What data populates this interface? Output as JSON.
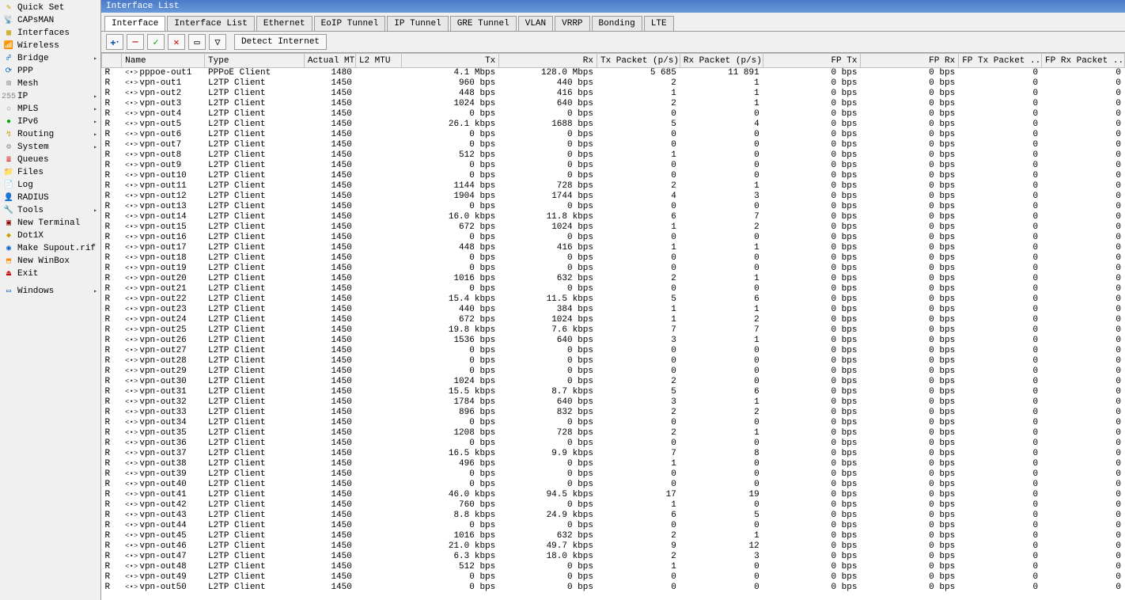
{
  "sidebar": [
    {
      "label": "Quick Set",
      "icon": "✎",
      "color": "#c8a000"
    },
    {
      "label": "CAPsMAN",
      "icon": "📡",
      "color": "#c00"
    },
    {
      "label": "Interfaces",
      "icon": "▦",
      "color": "#c8a000"
    },
    {
      "label": "Wireless",
      "icon": "📶",
      "color": "#06c"
    },
    {
      "label": "Bridge",
      "icon": "☍",
      "color": "#06c",
      "arrow": true
    },
    {
      "label": "PPP",
      "icon": "⟳",
      "color": "#06c"
    },
    {
      "label": "Mesh",
      "icon": "⊞",
      "color": "#888"
    },
    {
      "label": "IP",
      "icon": "255",
      "color": "#888",
      "arrow": true
    },
    {
      "label": "MPLS",
      "icon": "○",
      "color": "#888",
      "arrow": true
    },
    {
      "label": "IPv6",
      "icon": "●",
      "color": "#0a0",
      "arrow": true
    },
    {
      "label": "Routing",
      "icon": "↯",
      "color": "#c8a000",
      "arrow": true
    },
    {
      "label": "System",
      "icon": "⚙",
      "color": "#888",
      "arrow": true
    },
    {
      "label": "Queues",
      "icon": "≣",
      "color": "#c00"
    },
    {
      "label": "Files",
      "icon": "📁",
      "color": "#06c"
    },
    {
      "label": "Log",
      "icon": "📄",
      "color": "#888"
    },
    {
      "label": "RADIUS",
      "icon": "👤",
      "color": "#c8a000"
    },
    {
      "label": "Tools",
      "icon": "🔧",
      "color": "#888",
      "arrow": true
    },
    {
      "label": "New Terminal",
      "icon": "▣",
      "color": "#800"
    },
    {
      "label": "Dot1X",
      "icon": "◆",
      "color": "#c8a000"
    },
    {
      "label": "Make Supout.rif",
      "icon": "◉",
      "color": "#06c"
    },
    {
      "label": "New WinBox",
      "icon": "⬒",
      "color": "#f80"
    },
    {
      "label": "Exit",
      "icon": "⏏",
      "color": "#c00"
    }
  ],
  "windows_label": "Windows",
  "window_title": "Interface List",
  "tabs": [
    "Interface",
    "Interface List",
    "Ethernet",
    "EoIP Tunnel",
    "IP Tunnel",
    "GRE Tunnel",
    "VLAN",
    "VRRP",
    "Bonding",
    "LTE"
  ],
  "active_tab": 0,
  "detect_label": "Detect Internet",
  "columns": [
    "",
    "Name",
    "Type",
    "Actual MTU",
    "L2 MTU",
    "Tx",
    "Rx",
    "Tx Packet (p/s)",
    "Rx Packet (p/s)",
    "FP Tx",
    "FP Rx",
    "FP Tx Packet ...",
    "FP Rx Packet ..."
  ],
  "rows": [
    {
      "flag": "R",
      "name": "pppoe-out1",
      "type": "PPPoE Client",
      "mtu": "1480",
      "l2": "",
      "tx": "4.1 Mbps",
      "rx": "128.0 Mbps",
      "txp": "5 685",
      "rxp": "11 891",
      "fptx": "0 bps",
      "fprx": "0 bps",
      "fptxp": "0",
      "fprxp": "0"
    },
    {
      "flag": "R",
      "name": "vpn-out1",
      "type": "L2TP Client",
      "mtu": "1450",
      "l2": "",
      "tx": "960 bps",
      "rx": "440 bps",
      "txp": "2",
      "rxp": "1",
      "fptx": "0 bps",
      "fprx": "0 bps",
      "fptxp": "0",
      "fprxp": "0"
    },
    {
      "flag": "R",
      "name": "vpn-out2",
      "type": "L2TP Client",
      "mtu": "1450",
      "l2": "",
      "tx": "448 bps",
      "rx": "416 bps",
      "txp": "1",
      "rxp": "1",
      "fptx": "0 bps",
      "fprx": "0 bps",
      "fptxp": "0",
      "fprxp": "0"
    },
    {
      "flag": "R",
      "name": "vpn-out3",
      "type": "L2TP Client",
      "mtu": "1450",
      "l2": "",
      "tx": "1024 bps",
      "rx": "640 bps",
      "txp": "2",
      "rxp": "1",
      "fptx": "0 bps",
      "fprx": "0 bps",
      "fptxp": "0",
      "fprxp": "0"
    },
    {
      "flag": "R",
      "name": "vpn-out4",
      "type": "L2TP Client",
      "mtu": "1450",
      "l2": "",
      "tx": "0 bps",
      "rx": "0 bps",
      "txp": "0",
      "rxp": "0",
      "fptx": "0 bps",
      "fprx": "0 bps",
      "fptxp": "0",
      "fprxp": "0"
    },
    {
      "flag": "R",
      "name": "vpn-out5",
      "type": "L2TP Client",
      "mtu": "1450",
      "l2": "",
      "tx": "26.1 kbps",
      "rx": "1688 bps",
      "txp": "5",
      "rxp": "4",
      "fptx": "0 bps",
      "fprx": "0 bps",
      "fptxp": "0",
      "fprxp": "0"
    },
    {
      "flag": "R",
      "name": "vpn-out6",
      "type": "L2TP Client",
      "mtu": "1450",
      "l2": "",
      "tx": "0 bps",
      "rx": "0 bps",
      "txp": "0",
      "rxp": "0",
      "fptx": "0 bps",
      "fprx": "0 bps",
      "fptxp": "0",
      "fprxp": "0"
    },
    {
      "flag": "R",
      "name": "vpn-out7",
      "type": "L2TP Client",
      "mtu": "1450",
      "l2": "",
      "tx": "0 bps",
      "rx": "0 bps",
      "txp": "0",
      "rxp": "0",
      "fptx": "0 bps",
      "fprx": "0 bps",
      "fptxp": "0",
      "fprxp": "0"
    },
    {
      "flag": "R",
      "name": "vpn-out8",
      "type": "L2TP Client",
      "mtu": "1450",
      "l2": "",
      "tx": "512 bps",
      "rx": "0 bps",
      "txp": "1",
      "rxp": "0",
      "fptx": "0 bps",
      "fprx": "0 bps",
      "fptxp": "0",
      "fprxp": "0"
    },
    {
      "flag": "R",
      "name": "vpn-out9",
      "type": "L2TP Client",
      "mtu": "1450",
      "l2": "",
      "tx": "0 bps",
      "rx": "0 bps",
      "txp": "0",
      "rxp": "0",
      "fptx": "0 bps",
      "fprx": "0 bps",
      "fptxp": "0",
      "fprxp": "0"
    },
    {
      "flag": "R",
      "name": "vpn-out10",
      "type": "L2TP Client",
      "mtu": "1450",
      "l2": "",
      "tx": "0 bps",
      "rx": "0 bps",
      "txp": "0",
      "rxp": "0",
      "fptx": "0 bps",
      "fprx": "0 bps",
      "fptxp": "0",
      "fprxp": "0"
    },
    {
      "flag": "R",
      "name": "vpn-out11",
      "type": "L2TP Client",
      "mtu": "1450",
      "l2": "",
      "tx": "1144 bps",
      "rx": "728 bps",
      "txp": "2",
      "rxp": "1",
      "fptx": "0 bps",
      "fprx": "0 bps",
      "fptxp": "0",
      "fprxp": "0"
    },
    {
      "flag": "R",
      "name": "vpn-out12",
      "type": "L2TP Client",
      "mtu": "1450",
      "l2": "",
      "tx": "1904 bps",
      "rx": "1744 bps",
      "txp": "4",
      "rxp": "3",
      "fptx": "0 bps",
      "fprx": "0 bps",
      "fptxp": "0",
      "fprxp": "0"
    },
    {
      "flag": "R",
      "name": "vpn-out13",
      "type": "L2TP Client",
      "mtu": "1450",
      "l2": "",
      "tx": "0 bps",
      "rx": "0 bps",
      "txp": "0",
      "rxp": "0",
      "fptx": "0 bps",
      "fprx": "0 bps",
      "fptxp": "0",
      "fprxp": "0"
    },
    {
      "flag": "R",
      "name": "vpn-out14",
      "type": "L2TP Client",
      "mtu": "1450",
      "l2": "",
      "tx": "16.0 kbps",
      "rx": "11.8 kbps",
      "txp": "6",
      "rxp": "7",
      "fptx": "0 bps",
      "fprx": "0 bps",
      "fptxp": "0",
      "fprxp": "0"
    },
    {
      "flag": "R",
      "name": "vpn-out15",
      "type": "L2TP Client",
      "mtu": "1450",
      "l2": "",
      "tx": "672 bps",
      "rx": "1024 bps",
      "txp": "1",
      "rxp": "2",
      "fptx": "0 bps",
      "fprx": "0 bps",
      "fptxp": "0",
      "fprxp": "0"
    },
    {
      "flag": "R",
      "name": "vpn-out16",
      "type": "L2TP Client",
      "mtu": "1450",
      "l2": "",
      "tx": "0 bps",
      "rx": "0 bps",
      "txp": "0",
      "rxp": "0",
      "fptx": "0 bps",
      "fprx": "0 bps",
      "fptxp": "0",
      "fprxp": "0"
    },
    {
      "flag": "R",
      "name": "vpn-out17",
      "type": "L2TP Client",
      "mtu": "1450",
      "l2": "",
      "tx": "448 bps",
      "rx": "416 bps",
      "txp": "1",
      "rxp": "1",
      "fptx": "0 bps",
      "fprx": "0 bps",
      "fptxp": "0",
      "fprxp": "0"
    },
    {
      "flag": "R",
      "name": "vpn-out18",
      "type": "L2TP Client",
      "mtu": "1450",
      "l2": "",
      "tx": "0 bps",
      "rx": "0 bps",
      "txp": "0",
      "rxp": "0",
      "fptx": "0 bps",
      "fprx": "0 bps",
      "fptxp": "0",
      "fprxp": "0"
    },
    {
      "flag": "R",
      "name": "vpn-out19",
      "type": "L2TP Client",
      "mtu": "1450",
      "l2": "",
      "tx": "0 bps",
      "rx": "0 bps",
      "txp": "0",
      "rxp": "0",
      "fptx": "0 bps",
      "fprx": "0 bps",
      "fptxp": "0",
      "fprxp": "0"
    },
    {
      "flag": "R",
      "name": "vpn-out20",
      "type": "L2TP Client",
      "mtu": "1450",
      "l2": "",
      "tx": "1016 bps",
      "rx": "632 bps",
      "txp": "2",
      "rxp": "1",
      "fptx": "0 bps",
      "fprx": "0 bps",
      "fptxp": "0",
      "fprxp": "0"
    },
    {
      "flag": "R",
      "name": "vpn-out21",
      "type": "L2TP Client",
      "mtu": "1450",
      "l2": "",
      "tx": "0 bps",
      "rx": "0 bps",
      "txp": "0",
      "rxp": "0",
      "fptx": "0 bps",
      "fprx": "0 bps",
      "fptxp": "0",
      "fprxp": "0"
    },
    {
      "flag": "R",
      "name": "vpn-out22",
      "type": "L2TP Client",
      "mtu": "1450",
      "l2": "",
      "tx": "15.4 kbps",
      "rx": "11.5 kbps",
      "txp": "5",
      "rxp": "6",
      "fptx": "0 bps",
      "fprx": "0 bps",
      "fptxp": "0",
      "fprxp": "0"
    },
    {
      "flag": "R",
      "name": "vpn-out23",
      "type": "L2TP Client",
      "mtu": "1450",
      "l2": "",
      "tx": "440 bps",
      "rx": "384 bps",
      "txp": "1",
      "rxp": "1",
      "fptx": "0 bps",
      "fprx": "0 bps",
      "fptxp": "0",
      "fprxp": "0"
    },
    {
      "flag": "R",
      "name": "vpn-out24",
      "type": "L2TP Client",
      "mtu": "1450",
      "l2": "",
      "tx": "672 bps",
      "rx": "1024 bps",
      "txp": "1",
      "rxp": "2",
      "fptx": "0 bps",
      "fprx": "0 bps",
      "fptxp": "0",
      "fprxp": "0"
    },
    {
      "flag": "R",
      "name": "vpn-out25",
      "type": "L2TP Client",
      "mtu": "1450",
      "l2": "",
      "tx": "19.8 kbps",
      "rx": "7.6 kbps",
      "txp": "7",
      "rxp": "7",
      "fptx": "0 bps",
      "fprx": "0 bps",
      "fptxp": "0",
      "fprxp": "0"
    },
    {
      "flag": "R",
      "name": "vpn-out26",
      "type": "L2TP Client",
      "mtu": "1450",
      "l2": "",
      "tx": "1536 bps",
      "rx": "640 bps",
      "txp": "3",
      "rxp": "1",
      "fptx": "0 bps",
      "fprx": "0 bps",
      "fptxp": "0",
      "fprxp": "0"
    },
    {
      "flag": "R",
      "name": "vpn-out27",
      "type": "L2TP Client",
      "mtu": "1450",
      "l2": "",
      "tx": "0 bps",
      "rx": "0 bps",
      "txp": "0",
      "rxp": "0",
      "fptx": "0 bps",
      "fprx": "0 bps",
      "fptxp": "0",
      "fprxp": "0"
    },
    {
      "flag": "R",
      "name": "vpn-out28",
      "type": "L2TP Client",
      "mtu": "1450",
      "l2": "",
      "tx": "0 bps",
      "rx": "0 bps",
      "txp": "0",
      "rxp": "0",
      "fptx": "0 bps",
      "fprx": "0 bps",
      "fptxp": "0",
      "fprxp": "0"
    },
    {
      "flag": "R",
      "name": "vpn-out29",
      "type": "L2TP Client",
      "mtu": "1450",
      "l2": "",
      "tx": "0 bps",
      "rx": "0 bps",
      "txp": "0",
      "rxp": "0",
      "fptx": "0 bps",
      "fprx": "0 bps",
      "fptxp": "0",
      "fprxp": "0"
    },
    {
      "flag": "R",
      "name": "vpn-out30",
      "type": "L2TP Client",
      "mtu": "1450",
      "l2": "",
      "tx": "1024 bps",
      "rx": "0 bps",
      "txp": "2",
      "rxp": "0",
      "fptx": "0 bps",
      "fprx": "0 bps",
      "fptxp": "0",
      "fprxp": "0"
    },
    {
      "flag": "R",
      "name": "vpn-out31",
      "type": "L2TP Client",
      "mtu": "1450",
      "l2": "",
      "tx": "15.5 kbps",
      "rx": "8.7 kbps",
      "txp": "5",
      "rxp": "6",
      "fptx": "0 bps",
      "fprx": "0 bps",
      "fptxp": "0",
      "fprxp": "0"
    },
    {
      "flag": "R",
      "name": "vpn-out32",
      "type": "L2TP Client",
      "mtu": "1450",
      "l2": "",
      "tx": "1784 bps",
      "rx": "640 bps",
      "txp": "3",
      "rxp": "1",
      "fptx": "0 bps",
      "fprx": "0 bps",
      "fptxp": "0",
      "fprxp": "0"
    },
    {
      "flag": "R",
      "name": "vpn-out33",
      "type": "L2TP Client",
      "mtu": "1450",
      "l2": "",
      "tx": "896 bps",
      "rx": "832 bps",
      "txp": "2",
      "rxp": "2",
      "fptx": "0 bps",
      "fprx": "0 bps",
      "fptxp": "0",
      "fprxp": "0"
    },
    {
      "flag": "R",
      "name": "vpn-out34",
      "type": "L2TP Client",
      "mtu": "1450",
      "l2": "",
      "tx": "0 bps",
      "rx": "0 bps",
      "txp": "0",
      "rxp": "0",
      "fptx": "0 bps",
      "fprx": "0 bps",
      "fptxp": "0",
      "fprxp": "0"
    },
    {
      "flag": "R",
      "name": "vpn-out35",
      "type": "L2TP Client",
      "mtu": "1450",
      "l2": "",
      "tx": "1208 bps",
      "rx": "728 bps",
      "txp": "2",
      "rxp": "1",
      "fptx": "0 bps",
      "fprx": "0 bps",
      "fptxp": "0",
      "fprxp": "0"
    },
    {
      "flag": "R",
      "name": "vpn-out36",
      "type": "L2TP Client",
      "mtu": "1450",
      "l2": "",
      "tx": "0 bps",
      "rx": "0 bps",
      "txp": "0",
      "rxp": "0",
      "fptx": "0 bps",
      "fprx": "0 bps",
      "fptxp": "0",
      "fprxp": "0"
    },
    {
      "flag": "R",
      "name": "vpn-out37",
      "type": "L2TP Client",
      "mtu": "1450",
      "l2": "",
      "tx": "16.5 kbps",
      "rx": "9.9 kbps",
      "txp": "7",
      "rxp": "8",
      "fptx": "0 bps",
      "fprx": "0 bps",
      "fptxp": "0",
      "fprxp": "0"
    },
    {
      "flag": "R",
      "name": "vpn-out38",
      "type": "L2TP Client",
      "mtu": "1450",
      "l2": "",
      "tx": "496 bps",
      "rx": "0 bps",
      "txp": "1",
      "rxp": "0",
      "fptx": "0 bps",
      "fprx": "0 bps",
      "fptxp": "0",
      "fprxp": "0"
    },
    {
      "flag": "R",
      "name": "vpn-out39",
      "type": "L2TP Client",
      "mtu": "1450",
      "l2": "",
      "tx": "0 bps",
      "rx": "0 bps",
      "txp": "0",
      "rxp": "0",
      "fptx": "0 bps",
      "fprx": "0 bps",
      "fptxp": "0",
      "fprxp": "0"
    },
    {
      "flag": "R",
      "name": "vpn-out40",
      "type": "L2TP Client",
      "mtu": "1450",
      "l2": "",
      "tx": "0 bps",
      "rx": "0 bps",
      "txp": "0",
      "rxp": "0",
      "fptx": "0 bps",
      "fprx": "0 bps",
      "fptxp": "0",
      "fprxp": "0"
    },
    {
      "flag": "R",
      "name": "vpn-out41",
      "type": "L2TP Client",
      "mtu": "1450",
      "l2": "",
      "tx": "46.0 kbps",
      "rx": "94.5 kbps",
      "txp": "17",
      "rxp": "19",
      "fptx": "0 bps",
      "fprx": "0 bps",
      "fptxp": "0",
      "fprxp": "0"
    },
    {
      "flag": "R",
      "name": "vpn-out42",
      "type": "L2TP Client",
      "mtu": "1450",
      "l2": "",
      "tx": "760 bps",
      "rx": "0 bps",
      "txp": "1",
      "rxp": "0",
      "fptx": "0 bps",
      "fprx": "0 bps",
      "fptxp": "0",
      "fprxp": "0"
    },
    {
      "flag": "R",
      "name": "vpn-out43",
      "type": "L2TP Client",
      "mtu": "1450",
      "l2": "",
      "tx": "8.8 kbps",
      "rx": "24.9 kbps",
      "txp": "6",
      "rxp": "5",
      "fptx": "0 bps",
      "fprx": "0 bps",
      "fptxp": "0",
      "fprxp": "0"
    },
    {
      "flag": "R",
      "name": "vpn-out44",
      "type": "L2TP Client",
      "mtu": "1450",
      "l2": "",
      "tx": "0 bps",
      "rx": "0 bps",
      "txp": "0",
      "rxp": "0",
      "fptx": "0 bps",
      "fprx": "0 bps",
      "fptxp": "0",
      "fprxp": "0"
    },
    {
      "flag": "R",
      "name": "vpn-out45",
      "type": "L2TP Client",
      "mtu": "1450",
      "l2": "",
      "tx": "1016 bps",
      "rx": "632 bps",
      "txp": "2",
      "rxp": "1",
      "fptx": "0 bps",
      "fprx": "0 bps",
      "fptxp": "0",
      "fprxp": "0"
    },
    {
      "flag": "R",
      "name": "vpn-out46",
      "type": "L2TP Client",
      "mtu": "1450",
      "l2": "",
      "tx": "21.0 kbps",
      "rx": "49.7 kbps",
      "txp": "9",
      "rxp": "12",
      "fptx": "0 bps",
      "fprx": "0 bps",
      "fptxp": "0",
      "fprxp": "0"
    },
    {
      "flag": "R",
      "name": "vpn-out47",
      "type": "L2TP Client",
      "mtu": "1450",
      "l2": "",
      "tx": "6.3 kbps",
      "rx": "18.0 kbps",
      "txp": "2",
      "rxp": "3",
      "fptx": "0 bps",
      "fprx": "0 bps",
      "fptxp": "0",
      "fprxp": "0"
    },
    {
      "flag": "R",
      "name": "vpn-out48",
      "type": "L2TP Client",
      "mtu": "1450",
      "l2": "",
      "tx": "512 bps",
      "rx": "0 bps",
      "txp": "1",
      "rxp": "0",
      "fptx": "0 bps",
      "fprx": "0 bps",
      "fptxp": "0",
      "fprxp": "0"
    },
    {
      "flag": "R",
      "name": "vpn-out49",
      "type": "L2TP Client",
      "mtu": "1450",
      "l2": "",
      "tx": "0 bps",
      "rx": "0 bps",
      "txp": "0",
      "rxp": "0",
      "fptx": "0 bps",
      "fprx": "0 bps",
      "fptxp": "0",
      "fprxp": "0"
    },
    {
      "flag": "R",
      "name": "vpn-out50",
      "type": "L2TP Client",
      "mtu": "1450",
      "l2": "",
      "tx": "0 bps",
      "rx": "0 bps",
      "txp": "0",
      "rxp": "0",
      "fptx": "0 bps",
      "fprx": "0 bps",
      "fptxp": "0",
      "fprxp": "0"
    }
  ]
}
